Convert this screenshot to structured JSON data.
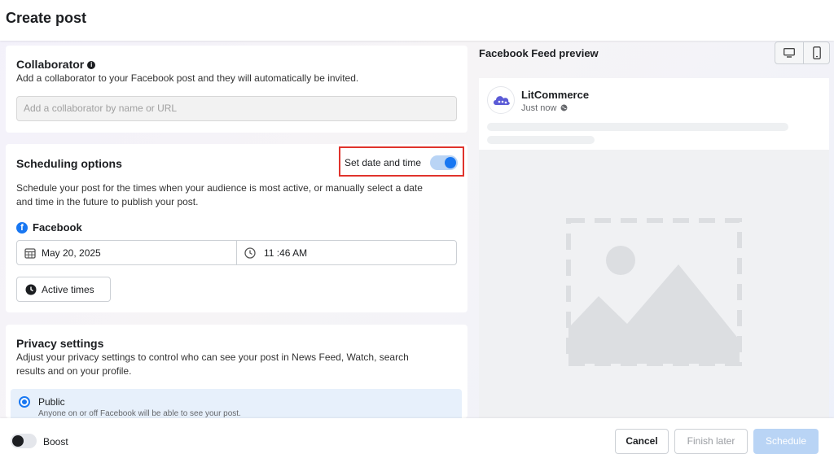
{
  "header": {
    "title": "Create post"
  },
  "collaborator": {
    "title": "Collaborator",
    "description": "Add a collaborator to your Facebook post and they will automatically be invited.",
    "placeholder": "Add a collaborator by name or URL"
  },
  "scheduling": {
    "title": "Scheduling options",
    "toggle_label": "Set date and time",
    "toggle_on": true,
    "description_line1": "Schedule your post for the times when your audience is most active, or manually select a date",
    "description_line2": "and time in the future to publish your post.",
    "platform": "Facebook",
    "date": "May 20, 2025",
    "time": "11 :46 AM",
    "active_times_label": "Active times"
  },
  "privacy": {
    "title": "Privacy settings",
    "description_line1": "Adjust your privacy settings to control who can see your post in News Feed, Watch, search",
    "description_line2": "results and on your profile.",
    "option_label": "Public",
    "option_sub": "Anyone on or off Facebook will be able to see your post."
  },
  "preview": {
    "title": "Facebook Feed preview",
    "page_name": "LitCommerce",
    "time": "Just now"
  },
  "footer": {
    "boost_label": "Boost",
    "cancel_label": "Cancel",
    "finish_later_label": "Finish later",
    "schedule_label": "Schedule"
  },
  "colors": {
    "accent": "#1877f2",
    "highlight_box": "#e0332c",
    "schedule_disabled": "#b9d4f5"
  },
  "icons": [
    "info-icon",
    "facebook-icon",
    "calendar-icon",
    "clock-icon",
    "desktop-icon",
    "mobile-icon",
    "globe-icon",
    "image-placeholder-icon"
  ]
}
